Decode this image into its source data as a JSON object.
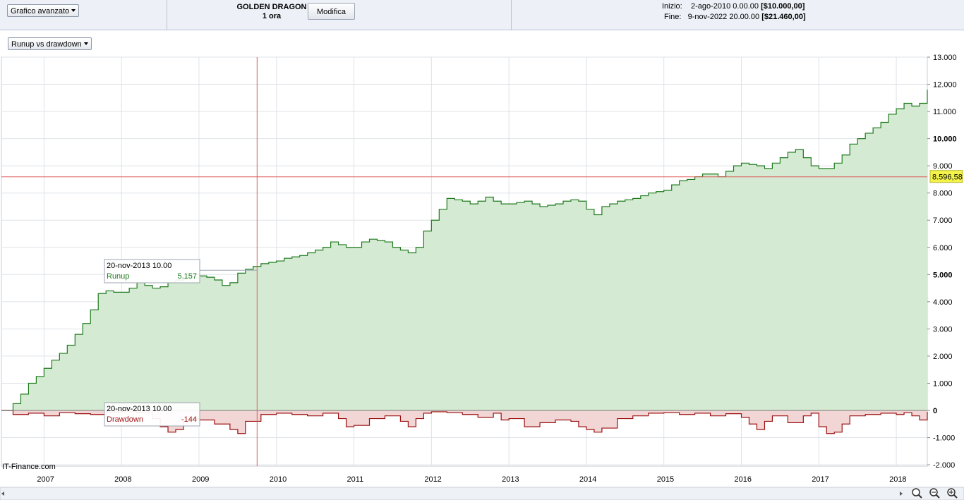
{
  "toolbar": {
    "chart_type": "Grafico avanzato",
    "strategy_name": "GOLDEN DRAGON",
    "timeframe": "1 ora",
    "modify_label": "Modifica",
    "start_label": "Inizio:",
    "start_date": "2-ago-2010 0.00.00",
    "start_value": "[$10.000,00]",
    "end_label": "Fine:",
    "end_date": "9-nov-2022 20.00.00",
    "end_value": "[$21.460,00]"
  },
  "view_selector": "Runup vs drawdown",
  "watermark": "IT-Finance.com",
  "crosshair": {
    "value_label": "8.596,58",
    "tooltip_runup": {
      "date": "20-nov-2013 10.00",
      "name": "Runup",
      "value": "5.157"
    },
    "tooltip_drawdown": {
      "date": "20-nov-2013 10.00",
      "name": "Drawdown",
      "value": "-144"
    }
  },
  "colors": {
    "runup_line": "#1e7a1e",
    "runup_fill": "#d5ead2",
    "drawdown_line": "#9b1010",
    "drawdown_fill": "#f2d6d6",
    "crosshair": "#e05a5a",
    "label_bg": "#f3f34a"
  },
  "chart_data": {
    "type": "area",
    "x_tick_labels": [
      "2007",
      "2008",
      "2009",
      "2010",
      "2011",
      "2012",
      "2013",
      "2014",
      "2015",
      "2016",
      "2017",
      "2018"
    ],
    "y_tick_labels": [
      "13.000",
      "12.000",
      "11.000",
      "10.000",
      "9.000",
      "8.000",
      "7.000",
      "6.000",
      "5.000",
      "4.000",
      "3.000",
      "2.000",
      "1.000",
      "0",
      "-1.000",
      "-2.000"
    ],
    "ylim": [
      -2200,
      13000
    ],
    "xlim": [
      2006.45,
      2018.4
    ],
    "series": [
      {
        "name": "Runup",
        "x": [
          2006.45,
          2006.6,
          2006.7,
          2006.8,
          2006.9,
          2007.0,
          2007.1,
          2007.2,
          2007.3,
          2007.4,
          2007.5,
          2007.6,
          2007.7,
          2007.8,
          2007.9,
          2008.0,
          2008.1,
          2008.2,
          2008.3,
          2008.4,
          2008.5,
          2008.6,
          2008.7,
          2008.8,
          2008.9,
          2009.0,
          2009.1,
          2009.2,
          2009.3,
          2009.4,
          2009.5,
          2009.6,
          2009.7,
          2009.8,
          2009.9,
          2010.0,
          2010.1,
          2010.2,
          2010.3,
          2010.4,
          2010.5,
          2010.6,
          2010.7,
          2010.8,
          2010.9,
          2011.0,
          2011.1,
          2011.2,
          2011.3,
          2011.4,
          2011.5,
          2011.6,
          2011.7,
          2011.8,
          2011.9,
          2012.0,
          2012.1,
          2012.2,
          2012.3,
          2012.4,
          2012.5,
          2012.6,
          2012.7,
          2012.8,
          2012.9,
          2013.0,
          2013.1,
          2013.2,
          2013.3,
          2013.4,
          2013.5,
          2013.6,
          2013.7,
          2013.8,
          2013.9,
          2014.0,
          2014.1,
          2014.2,
          2014.3,
          2014.4,
          2014.5,
          2014.6,
          2014.7,
          2014.8,
          2014.9,
          2015.0,
          2015.1,
          2015.2,
          2015.3,
          2015.4,
          2015.5,
          2015.6,
          2015.7,
          2015.8,
          2015.9,
          2016.0,
          2016.1,
          2016.2,
          2016.3,
          2016.4,
          2016.5,
          2016.6,
          2016.7,
          2016.8,
          2016.9,
          2017.0,
          2017.1,
          2017.2,
          2017.3,
          2017.4,
          2017.5,
          2017.6,
          2017.7,
          2017.8,
          2017.9,
          2018.0,
          2018.1,
          2018.2,
          2018.3,
          2018.4
        ],
        "values": [
          0,
          250,
          600,
          1000,
          1250,
          1550,
          1850,
          2100,
          2400,
          2800,
          3200,
          3700,
          4300,
          4400,
          4350,
          4350,
          4500,
          4700,
          4600,
          4500,
          4550,
          4700,
          4800,
          4900,
          5000,
          4950,
          4900,
          4800,
          4600,
          4700,
          5050,
          5200,
          5300,
          5400,
          5450,
          5500,
          5600,
          5650,
          5700,
          5800,
          5900,
          6000,
          6200,
          6100,
          6000,
          6000,
          6200,
          6300,
          6250,
          6200,
          6000,
          5900,
          5800,
          6000,
          6600,
          7000,
          7400,
          7800,
          7750,
          7700,
          7600,
          7700,
          7850,
          7700,
          7600,
          7600,
          7650,
          7700,
          7600,
          7500,
          7550,
          7600,
          7700,
          7750,
          7700,
          7400,
          7200,
          7500,
          7600,
          7700,
          7750,
          7800,
          7900,
          8000,
          8050,
          8100,
          8300,
          8450,
          8500,
          8600,
          8700,
          8700,
          8600,
          8800,
          9000,
          9100,
          9050,
          9000,
          8900,
          9100,
          9300,
          9500,
          9600,
          9300,
          9000,
          8900,
          8900,
          9100,
          9400,
          9800,
          10000,
          10200,
          10400,
          10600,
          10900,
          11100,
          11300,
          11200,
          11300,
          11800
        ]
      },
      {
        "name": "Drawdown",
        "x": [
          2006.45,
          2006.6,
          2006.8,
          2007.0,
          2007.2,
          2007.4,
          2007.6,
          2007.8,
          2008.0,
          2008.2,
          2008.4,
          2008.5,
          2008.6,
          2008.7,
          2008.8,
          2008.9,
          2009.0,
          2009.2,
          2009.4,
          2009.5,
          2009.6,
          2009.8,
          2010.0,
          2010.2,
          2010.4,
          2010.6,
          2010.8,
          2010.9,
          2011.0,
          2011.2,
          2011.4,
          2011.6,
          2011.7,
          2011.8,
          2011.9,
          2012.0,
          2012.2,
          2012.4,
          2012.6,
          2012.8,
          2012.9,
          2013.0,
          2013.2,
          2013.4,
          2013.6,
          2013.8,
          2013.9,
          2014.0,
          2014.1,
          2014.2,
          2014.4,
          2014.6,
          2014.8,
          2015.0,
          2015.2,
          2015.4,
          2015.6,
          2015.8,
          2016.0,
          2016.1,
          2016.2,
          2016.3,
          2016.4,
          2016.6,
          2016.8,
          2016.9,
          2017.0,
          2017.1,
          2017.2,
          2017.3,
          2017.4,
          2017.6,
          2017.8,
          2018.0,
          2018.1,
          2018.2,
          2018.3,
          2018.4
        ],
        "values": [
          0,
          -150,
          -100,
          -200,
          -80,
          -120,
          -150,
          -60,
          -50,
          -80,
          -300,
          -600,
          -800,
          -700,
          -400,
          -300,
          -350,
          -500,
          -700,
          -850,
          -400,
          -150,
          -100,
          -150,
          -200,
          -100,
          -300,
          -600,
          -550,
          -300,
          -200,
          -400,
          -600,
          -300,
          -100,
          -50,
          -80,
          -150,
          -250,
          -100,
          -350,
          -300,
          -600,
          -450,
          -350,
          -400,
          -600,
          -700,
          -800,
          -650,
          -300,
          -200,
          -100,
          -80,
          -150,
          -100,
          -200,
          -120,
          -250,
          -500,
          -700,
          -400,
          -200,
          -450,
          -200,
          -100,
          -600,
          -850,
          -800,
          -500,
          -200,
          -150,
          -100,
          -150,
          -80,
          -200,
          -350,
          -50
        ]
      }
    ],
    "crosshair_x": 2009.75
  }
}
